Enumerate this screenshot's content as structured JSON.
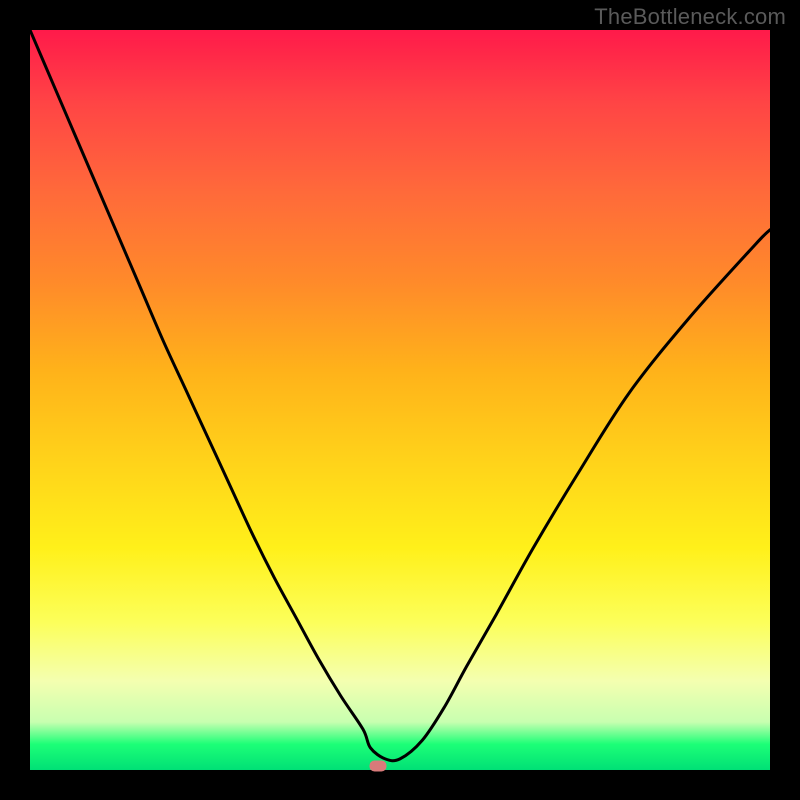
{
  "watermark": "TheBottleneck.com",
  "colors": {
    "frame": "#000000",
    "curve": "#000000",
    "marker": "#d87a7a"
  },
  "chart_data": {
    "type": "line",
    "title": "",
    "xlabel": "",
    "ylabel": "",
    "xlim": [
      0,
      100
    ],
    "ylim": [
      0,
      100
    ],
    "grid": false,
    "legend": false,
    "series": [
      {
        "name": "bottleneck-curve",
        "x": [
          0,
          3,
          6,
          9,
          12,
          15,
          18,
          21,
          24,
          27,
          30,
          33,
          36,
          39,
          42,
          45,
          46,
          48,
          50,
          53,
          56,
          59,
          63,
          68,
          74,
          81,
          89,
          98,
          100
        ],
        "y": [
          100,
          93,
          86,
          79,
          72,
          65,
          58,
          51.5,
          45,
          38.5,
          32,
          26,
          20.5,
          15,
          10,
          5.5,
          3,
          1.5,
          1.5,
          4,
          8.5,
          14,
          21,
          30,
          40,
          51,
          61,
          71,
          73
        ]
      }
    ],
    "marker": {
      "x": 47,
      "y": 0.5
    },
    "background_gradient": {
      "direction": "vertical",
      "stops": [
        {
          "pct": 0,
          "color": "#ff1a4a"
        },
        {
          "pct": 22,
          "color": "#ff6a3a"
        },
        {
          "pct": 46,
          "color": "#ffb21a"
        },
        {
          "pct": 70,
          "color": "#fff01a"
        },
        {
          "pct": 88,
          "color": "#f4ffb0"
        },
        {
          "pct": 96,
          "color": "#1dff77"
        },
        {
          "pct": 100,
          "color": "#00e076"
        }
      ]
    }
  }
}
